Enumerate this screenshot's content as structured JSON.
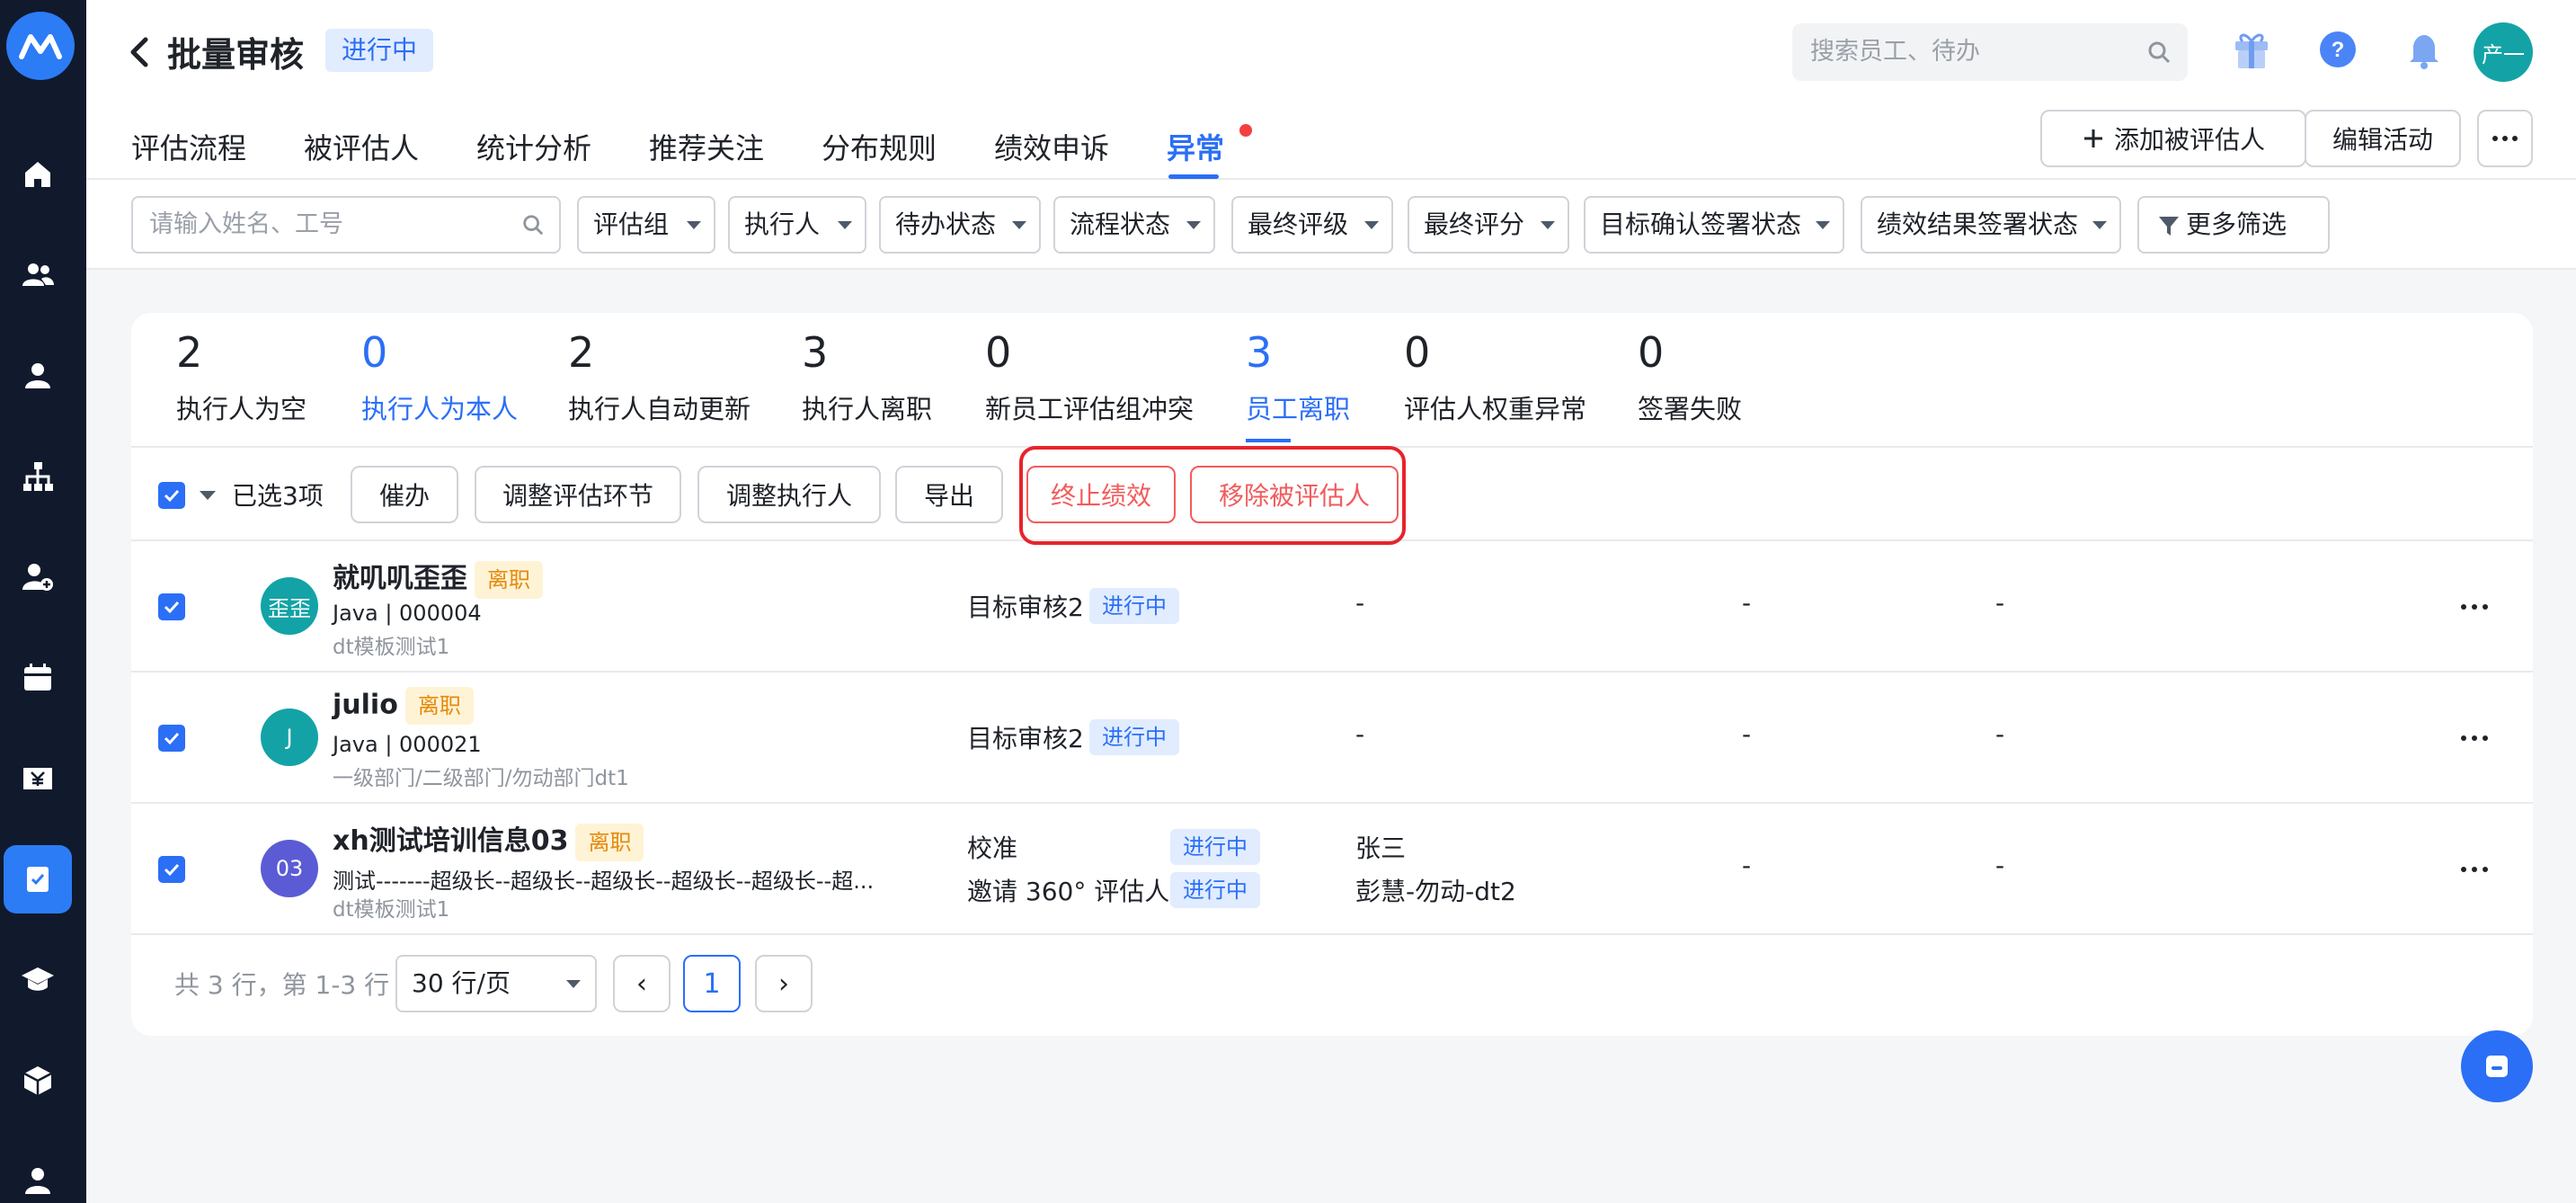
{
  "header": {
    "title": "批量审核",
    "status": "进行中",
    "search_placeholder": "搜索员工、待办",
    "user_avatar": "产一",
    "add_label": "添加被评估人",
    "edit_label": "编辑活动"
  },
  "tabs": [
    "评估流程",
    "被评估人",
    "统计分析",
    "推荐关注",
    "分布规则",
    "绩效申诉",
    "异常"
  ],
  "filters": {
    "search_placeholder": "请输入姓名、工号",
    "items": [
      "评估组",
      "执行人",
      "待办状态",
      "流程状态",
      "最终评级",
      "最终评分",
      "目标确认签署状态",
      "绩效结果签署状态"
    ],
    "more": "更多筛选"
  },
  "stats": [
    {
      "num": "2",
      "label": "执行人为空"
    },
    {
      "num": "0",
      "label": "执行人为本人"
    },
    {
      "num": "2",
      "label": "执行人自动更新"
    },
    {
      "num": "3",
      "label": "执行人离职"
    },
    {
      "num": "0",
      "label": "新员工评估组冲突"
    },
    {
      "num": "3",
      "label": "员工离职"
    },
    {
      "num": "0",
      "label": "评估人权重异常"
    },
    {
      "num": "0",
      "label": "签署失败"
    }
  ],
  "actions": {
    "selected": "已选3项",
    "buttons": [
      "催办",
      "调整评估环节",
      "调整执行人",
      "导出",
      "终止绩效",
      "移除被评估人"
    ]
  },
  "rows": [
    {
      "avatar": "歪歪",
      "avatar_color": "#13a3a6",
      "name": "就叽叽歪歪",
      "tag": "离职",
      "sub1": "Java | 000004",
      "sub2": "dt模板测试1",
      "stage": "目标审核2",
      "stage_status": "进行中",
      "executor": "-",
      "col4": "-",
      "col5": "-"
    },
    {
      "avatar": "J",
      "avatar_color": "#13a3a6",
      "name": "julio",
      "tag": "离职",
      "sub1": "Java | 000021",
      "sub2": "一级部门/二级部门/勿动部门dt1",
      "stage": "目标审核2",
      "stage_status": "进行中",
      "executor": "-",
      "col4": "-",
      "col5": "-"
    },
    {
      "avatar": "03",
      "avatar_color": "#5b5bd6",
      "name": "xh测试培训信息03",
      "tag": "离职",
      "sub1": "测试-------超级长--超级长--超级长--超级长--超级长--超...",
      "sub2": "dt模板测试1",
      "stage": "校准",
      "stage_status": "进行中",
      "stage2": "邀请 360° 评估人",
      "stage2_status": "进行中",
      "executor": "张三",
      "executor2": "彭慧-勿动-dt2",
      "col4": "-",
      "col5": "-"
    }
  ],
  "pager": {
    "summary": "共 3 行，第 1-3 行",
    "page_size": "30 行/页",
    "prev": "‹",
    "current": "1",
    "next": "›"
  },
  "colors": {
    "accent": "#2b6ff6",
    "sidebar": "#101a2c",
    "danger": "#f25b5b",
    "leave": "#e58a0c"
  }
}
